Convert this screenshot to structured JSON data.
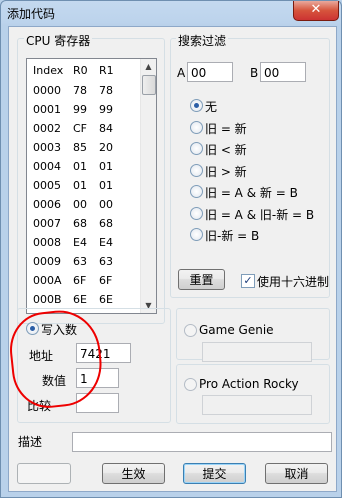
{
  "window": {
    "title": "添加代码",
    "close_glyph": "✕"
  },
  "cpu_group": {
    "title": "CPU 寄存器",
    "columns": [
      "Index",
      "R0",
      "R1"
    ],
    "rows": [
      [
        "0000",
        "78",
        "78"
      ],
      [
        "0001",
        "99",
        "99"
      ],
      [
        "0002",
        "CF",
        "84"
      ],
      [
        "0003",
        "85",
        "20"
      ],
      [
        "0004",
        "01",
        "01"
      ],
      [
        "0005",
        "01",
        "01"
      ],
      [
        "0006",
        "00",
        "00"
      ],
      [
        "0007",
        "68",
        "68"
      ],
      [
        "0008",
        "E4",
        "E4"
      ],
      [
        "0009",
        "63",
        "63"
      ],
      [
        "000A",
        "6F",
        "6F"
      ],
      [
        "000B",
        "6E",
        "6E"
      ]
    ]
  },
  "search_group": {
    "title": "搜索过滤",
    "a_label": "A",
    "a_value": "00",
    "b_label": "B",
    "b_value": "00",
    "options": [
      "无",
      "旧 = 新",
      "旧 < 新",
      "旧 > 新",
      "旧 = A & 新 = B",
      "旧 = A & 旧-新 = B",
      "旧-新 = B"
    ],
    "selected_index": 0,
    "reset_label": "重置",
    "hex_label": "使用十六进制",
    "hex_checked": true
  },
  "write_group": {
    "write_label": "写入数",
    "address_label": "地址",
    "address_value": "7421",
    "value_label": "数值",
    "value_value": "1",
    "compare_label": "比较",
    "compare_value": ""
  },
  "gg_group": {
    "label": "Game Genie"
  },
  "par_group": {
    "label": "Pro Action Rocky"
  },
  "description": {
    "label": "描述",
    "value": ""
  },
  "buttons": {
    "apply": "生效",
    "submit": "提交",
    "cancel": "取消"
  },
  "colors": {
    "annotation": "#e00000",
    "selected_radio": "#2b5ea6"
  }
}
